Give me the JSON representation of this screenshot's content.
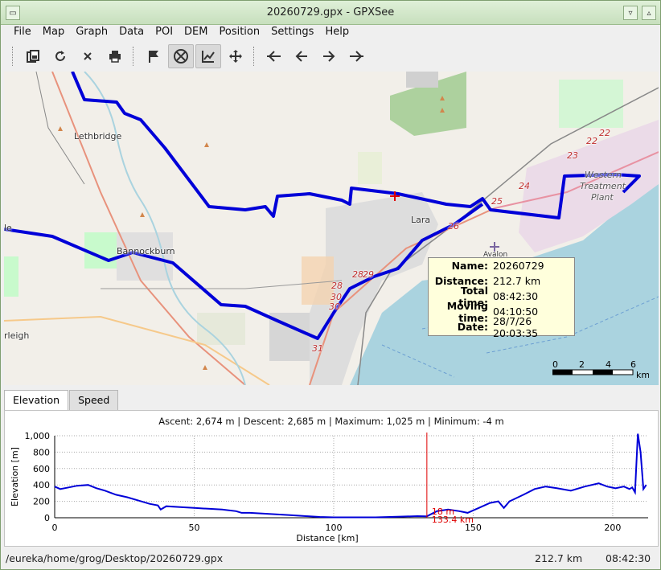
{
  "window": {
    "title": "20260729.gpx - GPXSee"
  },
  "menu": [
    "File",
    "Map",
    "Graph",
    "Data",
    "POI",
    "DEM",
    "Position",
    "Settings",
    "Help"
  ],
  "toolbar": [
    {
      "name": "open-icon",
      "glyph": "⎘"
    },
    {
      "name": "reload-icon",
      "glyph": "⟳"
    },
    {
      "name": "close-file-icon",
      "glyph": "✕"
    },
    {
      "name": "print-icon",
      "glyph": "⎙"
    },
    {
      "name": "flag-icon",
      "glyph": "⚑"
    },
    {
      "name": "hide-map-icon",
      "glyph": "⊗"
    },
    {
      "name": "show-graphs-icon",
      "glyph": "📈"
    },
    {
      "name": "fullscreen-icon",
      "glyph": "✥"
    },
    {
      "name": "first-file-icon",
      "glyph": "⇤"
    },
    {
      "name": "previous-file-icon",
      "glyph": "←"
    },
    {
      "name": "next-file-icon",
      "glyph": "→"
    },
    {
      "name": "last-file-icon",
      "glyph": "⇥"
    }
  ],
  "map": {
    "labels": {
      "lethbridge": "Lethbridge",
      "bannockburn": "Bannockburn",
      "lara": "Lara",
      "western": "Western",
      "treatment": "Treatment",
      "plant": "Plant",
      "avalon": "Avalon",
      "rleigh": "rleigh",
      "le": "le"
    },
    "markers": [
      "22",
      "22",
      "23",
      "24",
      "25",
      "26",
      "28",
      "29",
      "28",
      "30",
      "30",
      "31"
    ],
    "scale": {
      "ticks": [
        "0",
        "2",
        "4",
        "6"
      ],
      "unit": "km"
    }
  },
  "info": {
    "name_label": "Name:",
    "name": "20260729",
    "distance_label": "Distance:",
    "distance": "212.7 km",
    "total_time_label": "Total time:",
    "total_time": "08:42:30",
    "moving_time_label": "Moving time:",
    "moving_time": "04:10:50",
    "date_label": "Date:",
    "date": "28/7/26 20:03:35"
  },
  "tabs": {
    "elevation": "Elevation",
    "speed": "Speed"
  },
  "graph": {
    "summary": "Ascent: 2,674 m  |  Descent: 2,685 m  |  Maximum: 1,025 m  |  Minimum: -4 m",
    "cursor_elev": "18 m",
    "cursor_dist": "133.4 km"
  },
  "chart_data": {
    "type": "line",
    "xlabel": "Distance [km]",
    "ylabel": "Elevation [m]",
    "xlim": [
      0,
      212.7
    ],
    "ylim": [
      0,
      1000
    ],
    "x_ticks": [
      "0",
      "50",
      "100",
      "150",
      "200"
    ],
    "y_ticks": [
      "0",
      "200",
      "400",
      "600",
      "800",
      "1,000"
    ],
    "series": [
      {
        "x": [
          0,
          2,
          5,
          8,
          12,
          15,
          18,
          22,
          26,
          30,
          34,
          37,
          38,
          40,
          45,
          50,
          55,
          60,
          65,
          67,
          70,
          75,
          80,
          85,
          90,
          95,
          100,
          105,
          110,
          115,
          120,
          125,
          130,
          133.4,
          137,
          141,
          145,
          148,
          152,
          156,
          159,
          161,
          163,
          168,
          172,
          176,
          180,
          185,
          190,
          195,
          198,
          201,
          204,
          206,
          207,
          208,
          209,
          210,
          211,
          212
        ],
        "y": [
          380,
          350,
          370,
          390,
          400,
          360,
          330,
          280,
          250,
          210,
          170,
          150,
          100,
          140,
          130,
          120,
          110,
          100,
          80,
          60,
          60,
          50,
          40,
          30,
          20,
          10,
          5,
          5,
          5,
          5,
          10,
          15,
          20,
          18,
          80,
          100,
          80,
          60,
          120,
          180,
          200,
          120,
          200,
          280,
          350,
          380,
          360,
          330,
          380,
          420,
          380,
          360,
          380,
          350,
          370,
          310,
          1025,
          800,
          350,
          400
        ]
      }
    ],
    "cursor_x": 133.4,
    "line_color": "#0000d8",
    "cursor_color": "#e00000"
  }
}
